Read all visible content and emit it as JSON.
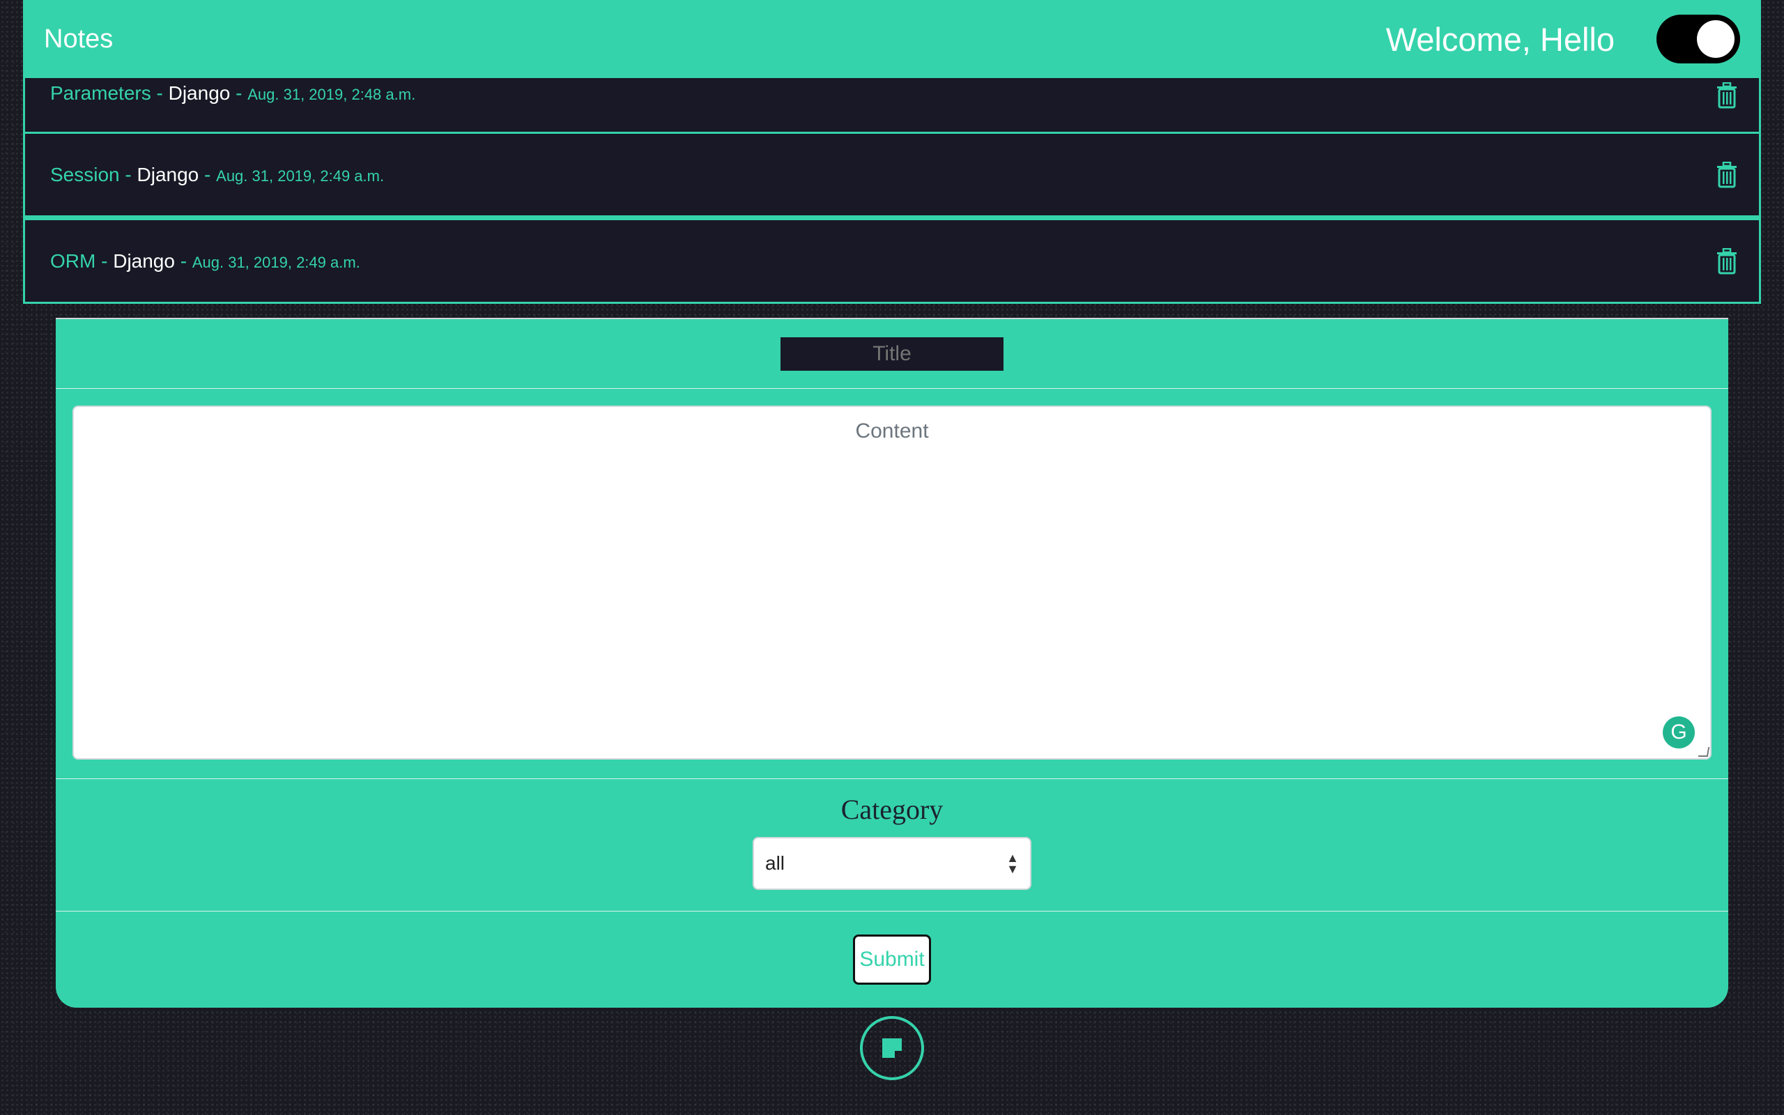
{
  "navbar": {
    "brand": "Notes",
    "welcome": "Welcome, Hello",
    "theme_toggle_state": "on"
  },
  "notes": [
    {
      "title": "Parameters",
      "separator": " - ",
      "category": "Django",
      "date": "Aug. 31, 2019, 2:48 a.m."
    },
    {
      "title": "Session",
      "separator": " - ",
      "category": "Django",
      "date": "Aug. 31, 2019, 2:49 a.m."
    },
    {
      "title": "ORM",
      "separator": " - ",
      "category": "Django",
      "date": "Aug. 31, 2019, 2:49 a.m."
    }
  ],
  "form": {
    "title_placeholder": "Title",
    "content_placeholder": "Content",
    "category_label": "Category",
    "category_selected": "all",
    "submit_label": "Submit"
  },
  "colors": {
    "accent": "#35d3ab",
    "dark": "#181826"
  },
  "icons": {
    "delete": "trash-icon",
    "grammarly": "grammarly-icon",
    "new_note": "sticky-note-icon"
  }
}
